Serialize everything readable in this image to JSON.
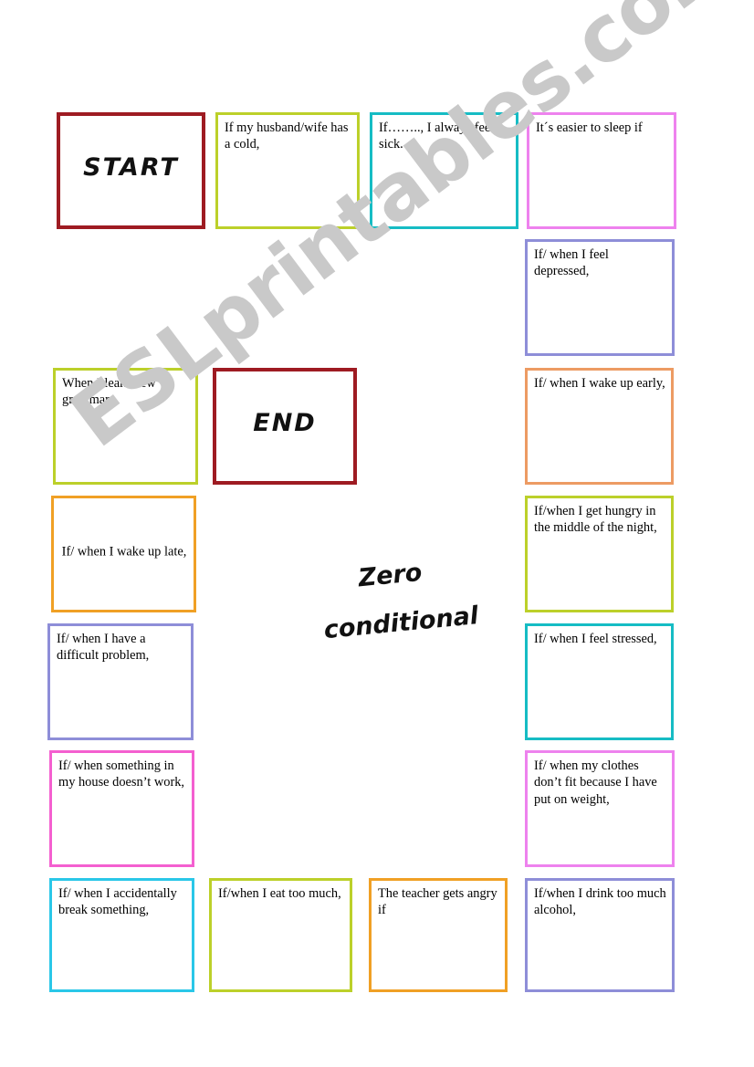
{
  "page": {
    "title": "Zero conditional",
    "title_line_1": "Zero",
    "title_line_2": "conditional",
    "watermark": "ESLprintables.com",
    "background_color": "#ffffff",
    "text_color": "#000000",
    "watermark_color": "#c9c9c9"
  },
  "palette": {
    "dark_red": "#9e1b22",
    "yellow_green": "#bcd02a",
    "teal": "#16bcc4",
    "pink": "#ee82ee",
    "periwinkle": "#8e8ed8",
    "peach": "#ed9b63",
    "orange": "#f0a025",
    "magenta": "#f45fd0",
    "cyan": "#2ac7e8"
  },
  "board": {
    "start_label": "START",
    "end_label": "END",
    "cells": [
      {
        "id": "start",
        "type": "terminal",
        "label": "START",
        "color": "#9e1b22",
        "align": "center"
      },
      {
        "id": "cell-01",
        "type": "prompt",
        "label": "If my husband/wife has a cold,",
        "color": "#bcd02a",
        "align": "left"
      },
      {
        "id": "cell-02",
        "type": "prompt",
        "label": "If…….., I always feel sick.",
        "color": "#16bcc4",
        "align": "left"
      },
      {
        "id": "cell-03",
        "type": "prompt",
        "label": "It´s easier to sleep if",
        "color": "#ee82ee",
        "align": "left"
      },
      {
        "id": "cell-04",
        "type": "prompt",
        "label": "If/ when I feel depressed,",
        "color": "#8e8ed8",
        "align": "left"
      },
      {
        "id": "cell-05",
        "type": "prompt",
        "label": "If/ when I wake up early,",
        "color": "#ed9b63",
        "align": "left"
      },
      {
        "id": "cell-06",
        "type": "prompt",
        "label": "If/when I get hungry in the middle of the night,",
        "color": "#bcd02a",
        "align": "left"
      },
      {
        "id": "cell-07",
        "type": "prompt",
        "label": "If/ when I feel stressed,",
        "color": "#16bcc4",
        "align": "left"
      },
      {
        "id": "cell-08",
        "type": "prompt",
        "label": "If/ when my clothes don’t fit because I have put on weight,",
        "color": "#ee82ee",
        "align": "left"
      },
      {
        "id": "cell-09",
        "type": "prompt",
        "label": "If/when I drink too much alcohol,",
        "color": "#8e8ed8",
        "align": "left"
      },
      {
        "id": "cell-10",
        "type": "prompt",
        "label": "The teacher gets angry if",
        "color": "#f0a025",
        "align": "left"
      },
      {
        "id": "cell-11",
        "type": "prompt",
        "label": "If/when I eat too much,",
        "color": "#bcd02a",
        "align": "left"
      },
      {
        "id": "cell-12",
        "type": "prompt",
        "label": "If/ when I accidentally break something,",
        "color": "#2ac7e8",
        "align": "left"
      },
      {
        "id": "cell-13",
        "type": "prompt",
        "label": "If/ when something in my house doesn’t work,",
        "color": "#f45fd0",
        "align": "left"
      },
      {
        "id": "cell-14",
        "type": "prompt",
        "label": "If/ when I have a difficult problem,",
        "color": "#8e8ed8",
        "align": "left"
      },
      {
        "id": "cell-15",
        "type": "prompt",
        "label": "If/ when I wake up late,",
        "color": "#f0a025",
        "align": "center"
      },
      {
        "id": "cell-16",
        "type": "prompt",
        "label": "When I learn new grammar,",
        "color": "#bcd02a",
        "align": "left"
      },
      {
        "id": "end",
        "type": "terminal",
        "label": "END",
        "color": "#9e1b22",
        "align": "center"
      }
    ]
  }
}
